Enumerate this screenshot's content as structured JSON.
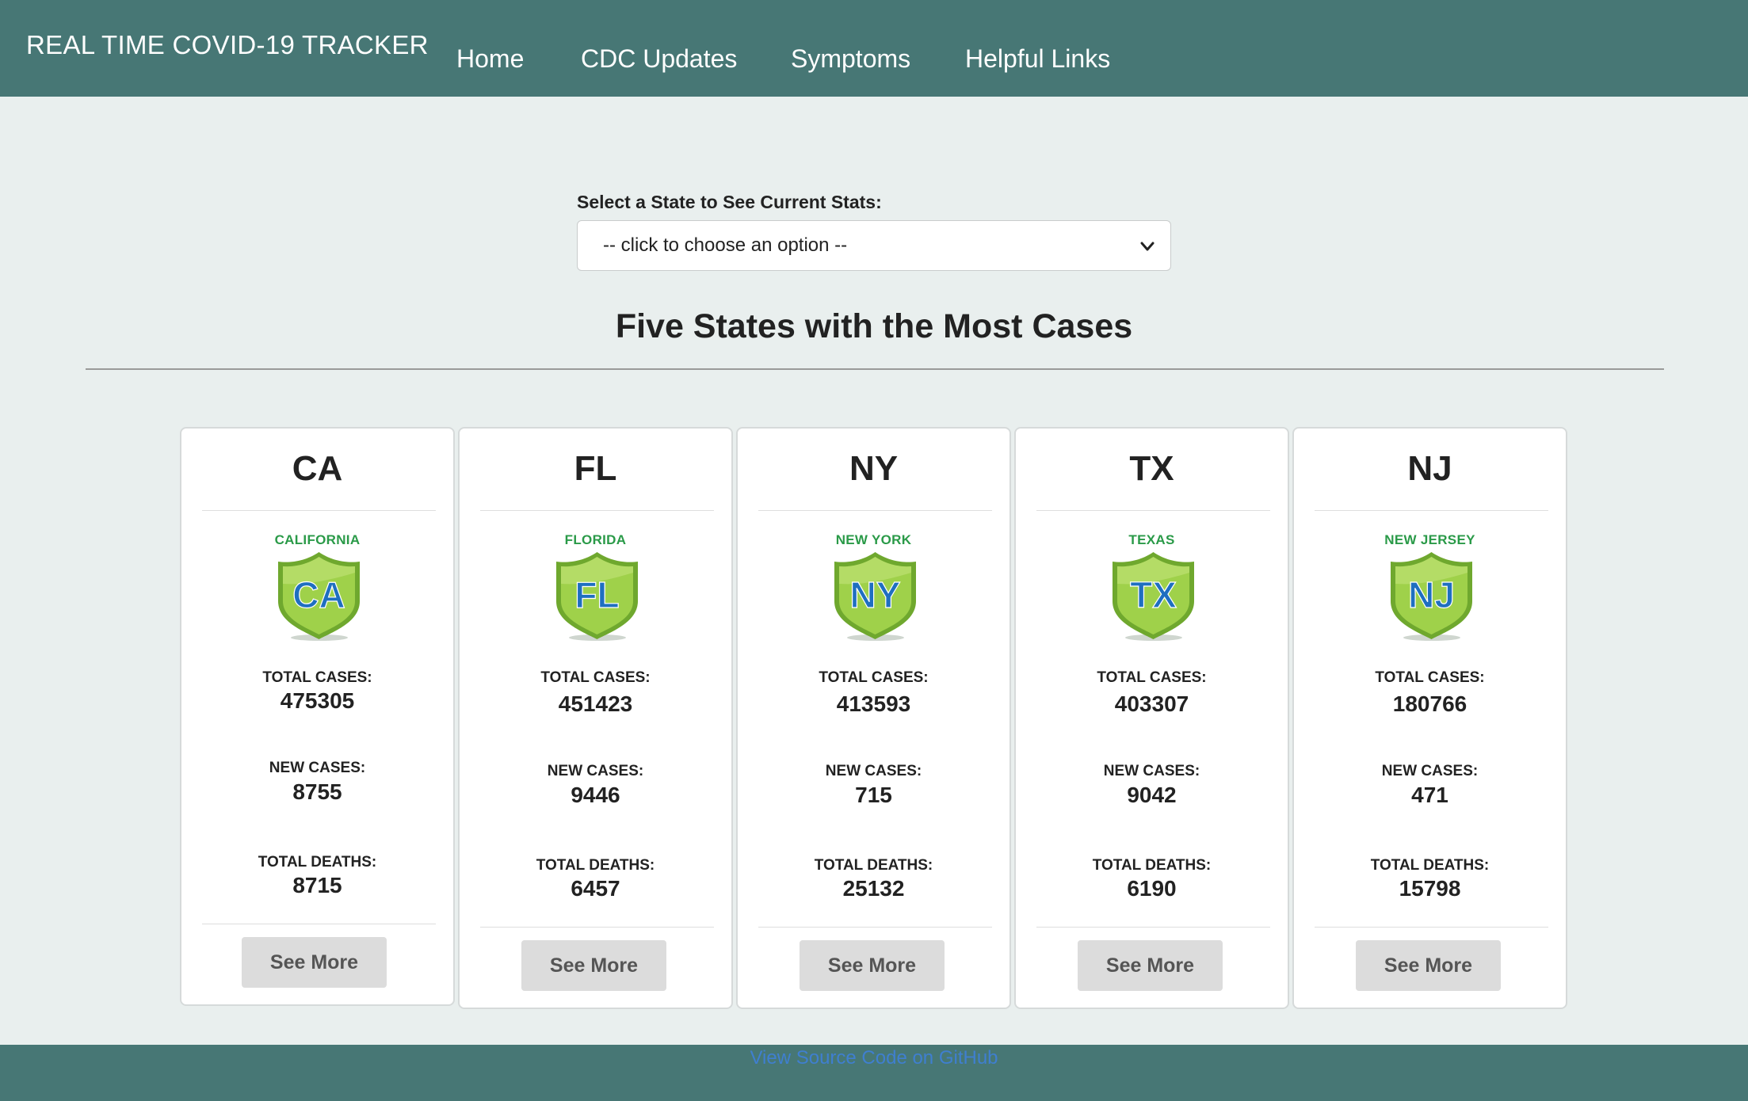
{
  "navbar": {
    "brand": "REAL TIME COVID-19 TRACKER",
    "links": [
      "Home",
      "CDC Updates",
      "Symptoms",
      "Helpful Links"
    ]
  },
  "selector": {
    "label": "Select a State to See Current Stats:",
    "selected": "-- click to choose an option --"
  },
  "section": {
    "title": "Five States with the Most Cases"
  },
  "stat_labels": {
    "total_cases": "TOTAL CASES:",
    "new_cases": "NEW CASES:",
    "total_deaths": "TOTAL DEATHS:"
  },
  "cards": [
    {
      "abbr": "CA",
      "badge_name": "CALIFORNIA",
      "badge_letters": "CA",
      "total_cases": "475305",
      "new_cases": "8755",
      "total_deaths": "8715",
      "button": "See More"
    },
    {
      "abbr": "FL",
      "badge_name": "FLORIDA",
      "badge_letters": "FL",
      "total_cases": "451423",
      "new_cases": "9446",
      "total_deaths": "6457",
      "button": "See More"
    },
    {
      "abbr": "NY",
      "badge_name": "NEW YORK",
      "badge_letters": "NY",
      "total_cases": "413593",
      "new_cases": "715",
      "total_deaths": "25132",
      "button": "See More"
    },
    {
      "abbr": "TX",
      "badge_name": "TEXAS",
      "badge_letters": "TX",
      "total_cases": "403307",
      "new_cases": "9042",
      "total_deaths": "6190",
      "button": "See More"
    },
    {
      "abbr": "NJ",
      "badge_name": "NEW JERSEY",
      "badge_letters": "NJ",
      "total_cases": "180766",
      "new_cases": "471",
      "total_deaths": "15798",
      "button": "See More"
    }
  ],
  "footer": {
    "link": "View Source Code on GitHub"
  },
  "colors": {
    "navbar": "#477775",
    "background": "#e9efee",
    "badge_green": "#8cc63f",
    "badge_letters": "#1f6fc0",
    "badge_name": "#2a9a48",
    "footer_link": "#3f7fd0"
  },
  "icons": [
    "chevron-down-icon",
    "state-shield-badge"
  ]
}
